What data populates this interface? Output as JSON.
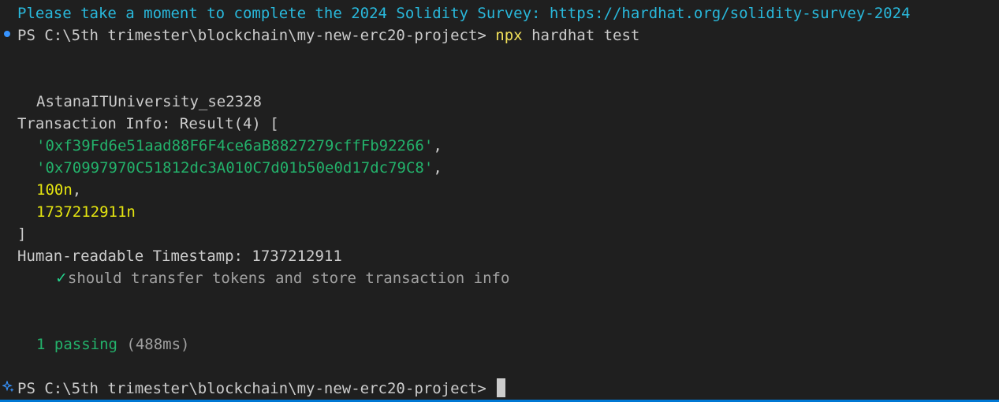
{
  "terminal": {
    "survey_notice": "Please take a moment to complete the 2024 Solidity Survey: https://hardhat.org/solidity-survey-2024",
    "prompt": "PS C:\\5th trimester\\blockchain\\my-new-erc20-project>",
    "command_npx": "npx",
    "command_rest": "hardhat test",
    "suite_name": "AstanaITUniversity_se2328",
    "tx_info_label": "Transaction Info: Result(4) [",
    "tx_address_from": "'0xf39Fd6e51aad88F6F4ce6aB8827279cffFb92266'",
    "tx_address_to": "'0x70997970C51812dc3A010C7d01b50e0d17dc79C8'",
    "tx_amount": "100n",
    "tx_timestamp": "1737212911n",
    "close_bracket": "]",
    "human_timestamp": "Human-readable Timestamp: 1737212911",
    "check_mark": "✓",
    "test_name": "should transfer tokens and store transaction info",
    "passing_count": "1 passing",
    "passing_time": "(488ms)",
    "final_prompt": "PS C:\\5th trimester\\blockchain\\my-new-erc20-project>",
    "comma": ","
  },
  "colors": {
    "background": "#1f1f1f",
    "info": "#29b8db",
    "command": "#f1e05a",
    "string": "#23b26b",
    "number": "#e5e510",
    "success": "#23d18b",
    "accent": "#0078d4"
  },
  "icons": {
    "prompt_dot": "command-decoration-dot-icon",
    "prompt_sparkle": "copilot-sparkle-icon"
  }
}
